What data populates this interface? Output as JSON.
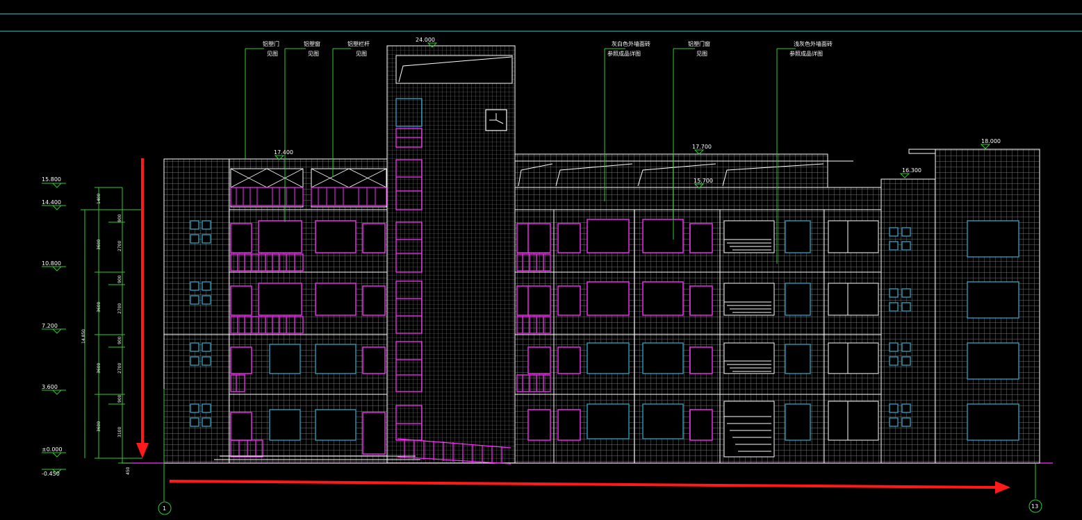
{
  "drawing": {
    "elevation_labels": [
      "24.000",
      "17.400",
      "17.700",
      "15.700",
      "16.300",
      "18.000"
    ],
    "left_levels": [
      "15.800",
      "14.400",
      "10.800",
      "7.200",
      "3.600",
      "±0.000",
      "-0.450"
    ],
    "dim_segments": [
      "1400",
      "3600",
      "3600",
      "3600",
      "3600"
    ],
    "dim_sub": [
      "900",
      "2700",
      "900",
      "2700",
      "900",
      "2700",
      "900",
      "3100"
    ],
    "dim_total": "14.850",
    "dim_base": "450",
    "axis_left": "1",
    "axis_right": "13",
    "callouts": [
      {
        "line1": "铝塑门",
        "line2": "见图"
      },
      {
        "line1": "铝塑窗",
        "line2": "见图"
      },
      {
        "line1": "铝塑栏杆",
        "line2": "见图"
      },
      {
        "line1": "灰白色外墙面砖",
        "line2": "参照成品详图"
      },
      {
        "line1": "铝塑门窗",
        "line2": "见图"
      },
      {
        "line1": "浅灰色外墙面砖",
        "line2": "参照成品详图"
      }
    ]
  },
  "colors": {
    "background": "#000000",
    "grid": "#b8b8b8",
    "outline": "#ffffff",
    "window_magenta": "#ff2dff",
    "window_cyan": "#2aa9c9",
    "leader_green": "#2bd12b",
    "guide_cyan": "#3fc7c7",
    "arrow_red": "#ff1a1a"
  }
}
